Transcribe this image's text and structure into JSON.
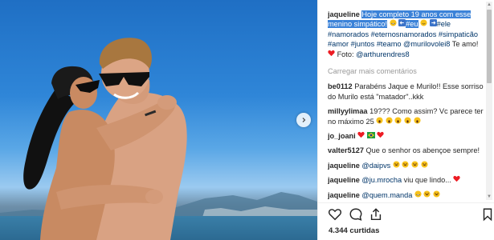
{
  "post": {
    "author": "jaqueline",
    "caption_highlight": "Hoje completo 19 anos com esse menino simpático!",
    "caption_tags": [
      "#eu",
      "#ele",
      "#namorados",
      "#eternosnamorados",
      "#simpaticão",
      "#amor",
      "#juntos",
      "#teamo"
    ],
    "caption_mention": "@murilovolei8",
    "caption_te_amo": "Te amo!",
    "caption_foto_label": "Foto:",
    "caption_photographer": "@arthurendres8"
  },
  "load_more_label": "Carregar mais comentários",
  "comments": [
    {
      "user": "be0112",
      "text": "Parabéns Jaque e Murilo!! Esse sorriso do Murilo está \"matador\"..kkk"
    },
    {
      "user": "millyylimaa",
      "text": "19??? Como assim? Vc parece ter no máximo 25"
    },
    {
      "user": "jo_joani",
      "text": ""
    },
    {
      "user": "valter5127",
      "text": "Que o senhor os abençoe sempre!"
    },
    {
      "user": "jaqueline",
      "mention": "@daipvs"
    },
    {
      "user": "jaqueline",
      "mention": "@ju.mrocha",
      "text": "viu que lindo..."
    },
    {
      "user": "jaqueline",
      "mention": "@quem.manda"
    }
  ],
  "likes_label": "4.344 curtidas",
  "icons": {
    "like": "heart-outline-icon",
    "comment": "comment-bubble-icon",
    "share": "share-upload-icon",
    "save": "bookmark-icon",
    "next": "chevron-right-icon"
  },
  "colors": {
    "highlight": "#3b82d8",
    "link": "#003569",
    "muted": "#999999",
    "heart": "#ed1c24",
    "emoji_yellow": "#f7c21b"
  }
}
